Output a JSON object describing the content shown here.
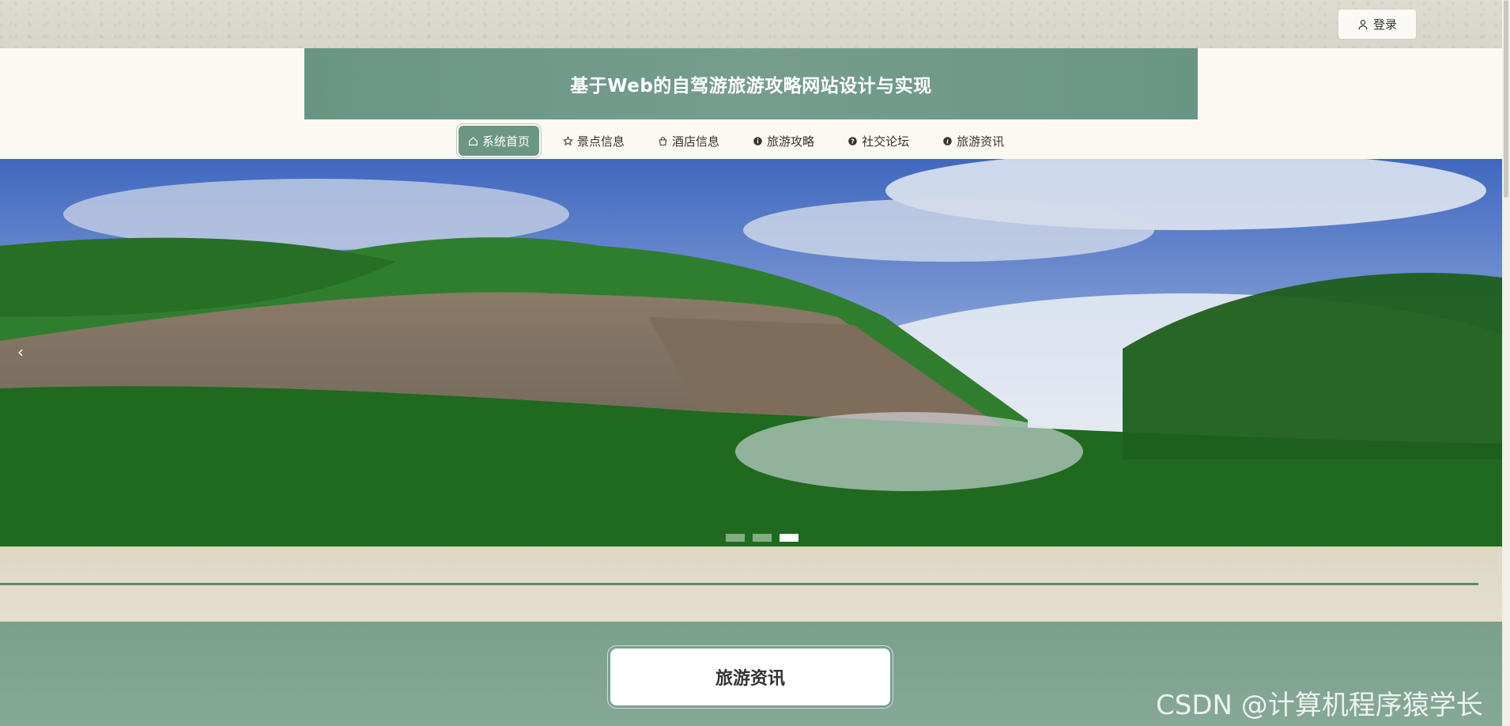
{
  "topbar": {
    "login_label": "登录",
    "login_icon": "user-icon"
  },
  "header": {
    "site_title": "基于Web的自驾游旅游攻略网站设计与实现"
  },
  "nav": {
    "items": [
      {
        "label": "系统首页",
        "icon": "home-icon",
        "active": true
      },
      {
        "label": "景点信息",
        "icon": "star-icon"
      },
      {
        "label": "酒店信息",
        "icon": "bag-icon"
      },
      {
        "label": "旅游攻略",
        "icon": "info-icon"
      },
      {
        "label": "社交论坛",
        "icon": "question-icon"
      },
      {
        "label": "旅游资讯",
        "icon": "info-icon"
      }
    ]
  },
  "banner": {
    "prev_glyph": "‹",
    "slides": 3,
    "active_slide": 3
  },
  "section": {
    "title": "旅游资讯"
  },
  "watermark": {
    "text": "CSDN @计算机程序猿学长"
  },
  "colors": {
    "accent": "#6c9684",
    "title_bg": "#6f9888",
    "section_bg": "#7ca08e"
  }
}
